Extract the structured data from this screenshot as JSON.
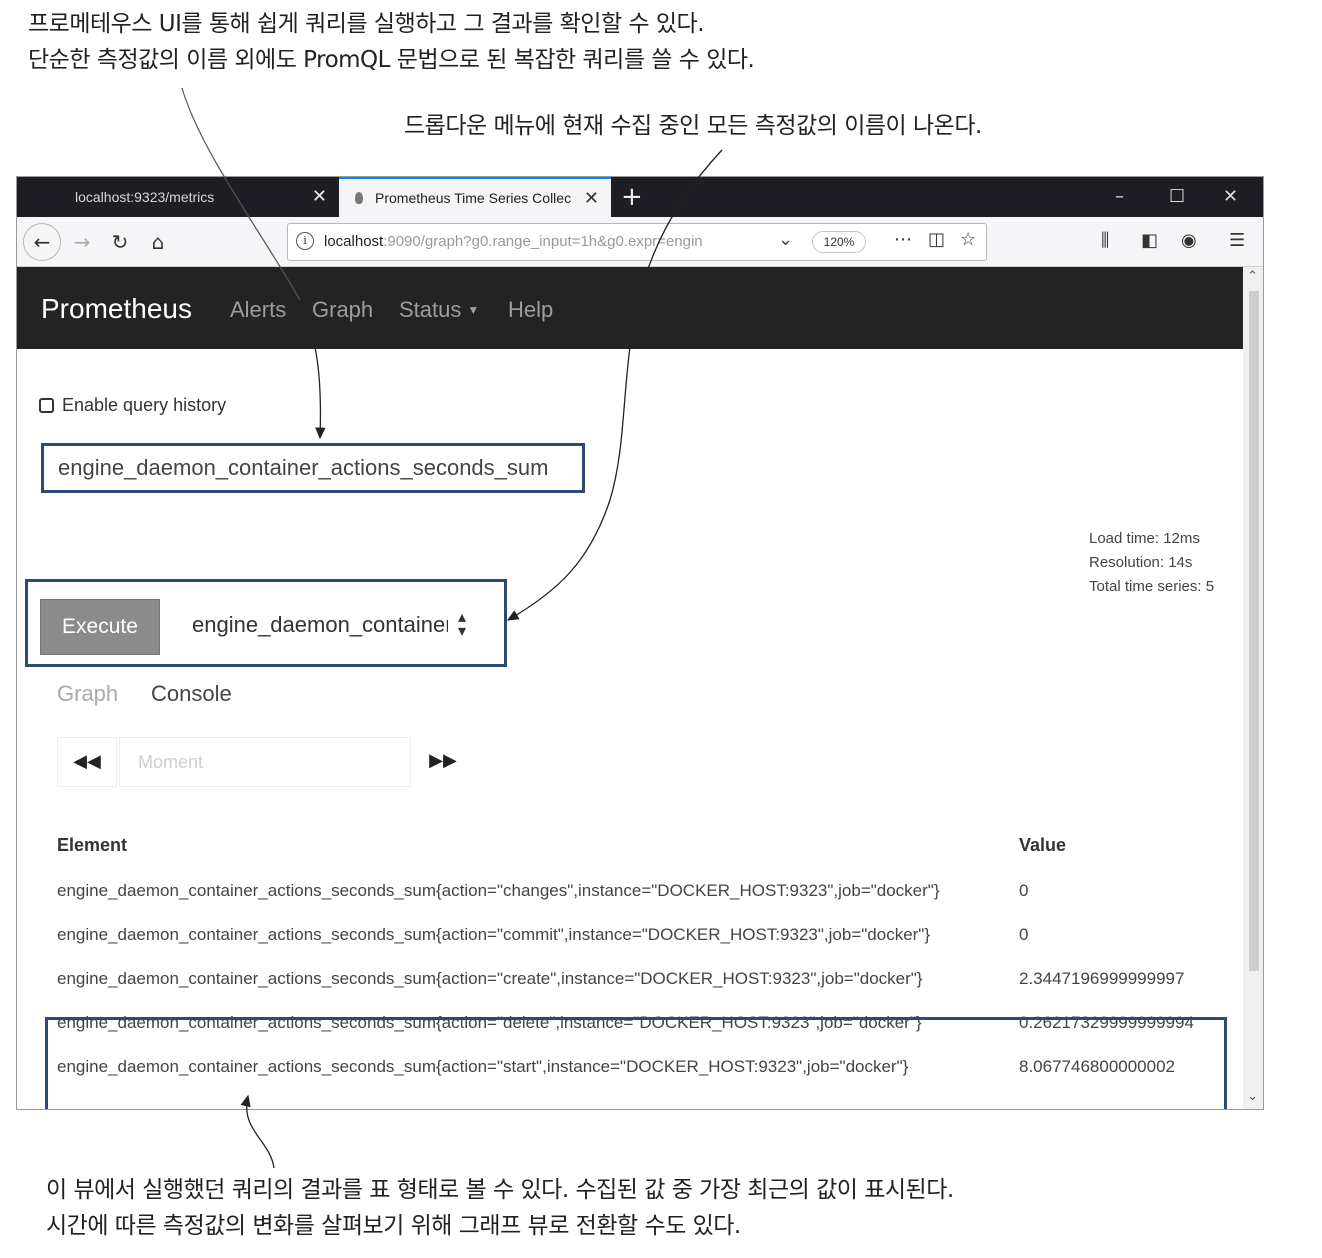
{
  "annotations": {
    "top_line1": "프로메테우스 UI를 통해 쉽게 쿼리를 실행하고 그 결과를 확인할 수 있다.",
    "top_line2": "단순한 측정값의 이름 외에도 PromQL 문법으로 된 복잡한 쿼리를 쓸 수 있다.",
    "middle": "드롭다운 메뉴에 현재 수집 중인 모든 측정값의 이름이 나온다.",
    "bottom_line1": "이 뷰에서 실행했던 쿼리의 결과를 표 형태로 볼 수 있다. 수집된 값 중 가장 최근의 값이 표시된다.",
    "bottom_line2": "시간에 따른 측정값의 변화를 살펴보기 위해 그래프 뷰로 전환할 수도 있다."
  },
  "browser": {
    "tabs": [
      {
        "title": "localhost:9323/metrics",
        "close": "✕"
      },
      {
        "title": "Prometheus Time Series Collec",
        "close": "✕"
      }
    ],
    "new_tab": "+",
    "url_host": "localhost",
    "url_rest": ":9090/graph?g0.range_input=1h&g0.expr=engin",
    "zoom": "120%",
    "icons": [
      "back-icon",
      "forward-icon",
      "reload-icon",
      "home-icon",
      "info-icon",
      "chevron-down-icon",
      "more-icon",
      "pocket-icon",
      "star-icon",
      "library-icon",
      "sidebar-icon",
      "account-icon",
      "menu-icon"
    ]
  },
  "prometheus": {
    "brand": "Prometheus",
    "nav": [
      "Alerts",
      "Graph",
      "Status",
      "Help"
    ],
    "history_label": "Enable query history",
    "query": "engine_daemon_container_actions_seconds_sum",
    "stats": [
      "Load time: 12ms",
      "Resolution: 14s",
      "Total time series: 5"
    ],
    "execute_label": "Execute",
    "metric_select": "engine_daemon_container_actions_seconds_sum",
    "tabs": [
      "Graph",
      "Console"
    ],
    "moment_placeholder": "Moment",
    "table": {
      "headers": [
        "Element",
        "Value"
      ],
      "rows": [
        {
          "element": "engine_daemon_container_actions_seconds_sum{action=\"changes\",instance=\"DOCKER_HOST:9323\",job=\"docker\"}",
          "value": "0"
        },
        {
          "element": "engine_daemon_container_actions_seconds_sum{action=\"commit\",instance=\"DOCKER_HOST:9323\",job=\"docker\"}",
          "value": "0"
        },
        {
          "element": "engine_daemon_container_actions_seconds_sum{action=\"create\",instance=\"DOCKER_HOST:9323\",job=\"docker\"}",
          "value": "2.3447196999999997"
        },
        {
          "element": "engine_daemon_container_actions_seconds_sum{action=\"delete\",instance=\"DOCKER_HOST:9323\",job=\"docker\"}",
          "value": "0.26217329999999994"
        },
        {
          "element": "engine_daemon_container_actions_seconds_sum{action=\"start\",instance=\"DOCKER_HOST:9323\",job=\"docker\"}",
          "value": "8.067746800000002"
        }
      ]
    }
  },
  "colors": {
    "callout_border": "#2d4a6f",
    "navbar_bg": "#232323",
    "tabbar_bg": "#1e1e24",
    "execute_bg": "#8b8b8b"
  }
}
